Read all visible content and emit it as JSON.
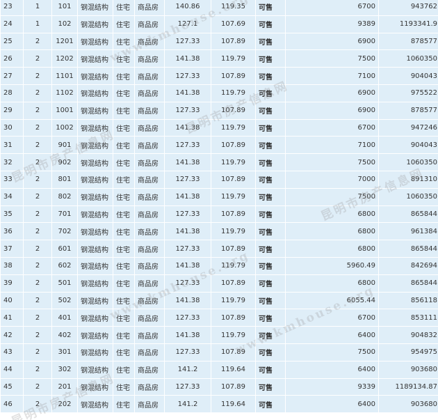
{
  "rows": [
    [
      "23",
      "1",
      "101",
      "钢混结构",
      "住宅",
      "商品房",
      "140.86",
      "119.35",
      "可售",
      "6700",
      "943762"
    ],
    [
      "24",
      "1",
      "102",
      "钢混结构",
      "住宅",
      "商品房",
      "127.1",
      "107.69",
      "可售",
      "9389",
      "1193341.9"
    ],
    [
      "25",
      "2",
      "1201",
      "钢混结构",
      "住宅",
      "商品房",
      "127.33",
      "107.89",
      "可售",
      "6900",
      "878577"
    ],
    [
      "26",
      "2",
      "1202",
      "钢混结构",
      "住宅",
      "商品房",
      "141.38",
      "119.79",
      "可售",
      "7500",
      "1060350"
    ],
    [
      "27",
      "2",
      "1101",
      "钢混结构",
      "住宅",
      "商品房",
      "127.33",
      "107.89",
      "可售",
      "7100",
      "904043"
    ],
    [
      "28",
      "2",
      "1102",
      "钢混结构",
      "住宅",
      "商品房",
      "141.38",
      "119.79",
      "可售",
      "6900",
      "975522"
    ],
    [
      "29",
      "2",
      "1001",
      "钢混结构",
      "住宅",
      "商品房",
      "127.33",
      "107.89",
      "可售",
      "6900",
      "878577"
    ],
    [
      "30",
      "2",
      "1002",
      "钢混结构",
      "住宅",
      "商品房",
      "141.38",
      "119.79",
      "可售",
      "6700",
      "947246"
    ],
    [
      "31",
      "2",
      "901",
      "钢混结构",
      "住宅",
      "商品房",
      "127.33",
      "107.89",
      "可售",
      "7100",
      "904043"
    ],
    [
      "32",
      "2",
      "902",
      "钢混结构",
      "住宅",
      "商品房",
      "141.38",
      "119.79",
      "可售",
      "7500",
      "1060350"
    ],
    [
      "33",
      "2",
      "801",
      "钢混结构",
      "住宅",
      "商品房",
      "127.33",
      "107.89",
      "可售",
      "7000",
      "891310"
    ],
    [
      "34",
      "2",
      "802",
      "钢混结构",
      "住宅",
      "商品房",
      "141.38",
      "119.79",
      "可售",
      "7500",
      "1060350"
    ],
    [
      "35",
      "2",
      "701",
      "钢混结构",
      "住宅",
      "商品房",
      "127.33",
      "107.89",
      "可售",
      "6800",
      "865844"
    ],
    [
      "36",
      "2",
      "702",
      "钢混结构",
      "住宅",
      "商品房",
      "141.38",
      "119.79",
      "可售",
      "6800",
      "961384"
    ],
    [
      "37",
      "2",
      "601",
      "钢混结构",
      "住宅",
      "商品房",
      "127.33",
      "107.89",
      "可售",
      "6800",
      "865844"
    ],
    [
      "38",
      "2",
      "602",
      "钢混结构",
      "住宅",
      "商品房",
      "141.38",
      "119.79",
      "可售",
      "5960.49",
      "842694"
    ],
    [
      "39",
      "2",
      "501",
      "钢混结构",
      "住宅",
      "商品房",
      "127.33",
      "107.89",
      "可售",
      "6800",
      "865844"
    ],
    [
      "40",
      "2",
      "502",
      "钢混结构",
      "住宅",
      "商品房",
      "141.38",
      "119.79",
      "可售",
      "6055.44",
      "856118"
    ],
    [
      "41",
      "2",
      "401",
      "钢混结构",
      "住宅",
      "商品房",
      "127.33",
      "107.89",
      "可售",
      "6700",
      "853111"
    ],
    [
      "42",
      "2",
      "402",
      "钢混结构",
      "住宅",
      "商品房",
      "141.38",
      "119.79",
      "可售",
      "6400",
      "904832"
    ],
    [
      "43",
      "2",
      "301",
      "钢混结构",
      "住宅",
      "商品房",
      "127.33",
      "107.89",
      "可售",
      "7500",
      "954975"
    ],
    [
      "44",
      "2",
      "302",
      "钢混结构",
      "住宅",
      "商品房",
      "141.2",
      "119.64",
      "可售",
      "6400",
      "903680"
    ],
    [
      "45",
      "2",
      "201",
      "钢混结构",
      "住宅",
      "商品房",
      "127.33",
      "107.89",
      "可售",
      "9339",
      "1189134.87"
    ],
    [
      "46",
      "2",
      "202",
      "钢混结构",
      "住宅",
      "商品房",
      "141.2",
      "119.64",
      "可售",
      "6400",
      "903680"
    ]
  ],
  "watermark": {
    "line1": "昆明市房产信息网",
    "line2": "www.kmhouse.org"
  },
  "colors": {
    "row_bg": "#dfeef8",
    "status_green": "#1c8a12",
    "room_blue": "#1c2f8f"
  }
}
